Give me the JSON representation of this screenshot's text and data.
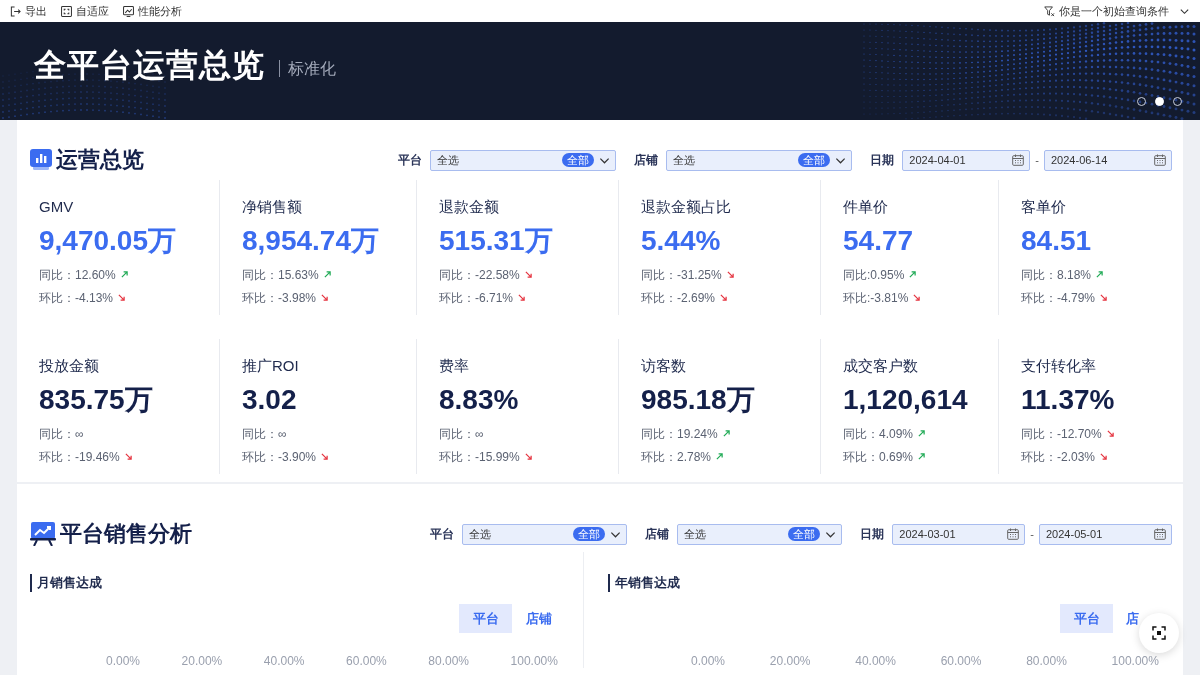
{
  "toolbar": {
    "items": [
      {
        "label": "导出"
      },
      {
        "label": "自适应"
      },
      {
        "label": "性能分析"
      }
    ],
    "query": {
      "label": "你是一个初始查询条件"
    }
  },
  "banner": {
    "title": "全平台运营总览",
    "subtitle": "标准化",
    "slides": [
      {
        "selected": false
      },
      {
        "selected": true
      },
      {
        "selected": false
      }
    ]
  },
  "sections": [
    {
      "kind": "kpi",
      "title": "运营总览",
      "filters": [
        {
          "kind": "select",
          "label": "平台",
          "value": "全选",
          "badge": "全部"
        },
        {
          "kind": "select",
          "label": "店铺",
          "value": "全选",
          "badge": "全部"
        },
        {
          "kind": "date_range",
          "label": "日期",
          "start": "2024-04-01",
          "separator": "-",
          "end": "2024-06-14"
        }
      ],
      "kpi_rows": [
        {
          "highlighted": true,
          "items": [
            {
              "label": "GMV",
              "value": "9,470.05万",
              "comparisons": [
                {
                  "kind": "up",
                  "text": "同比：12.60%"
                },
                {
                  "kind": "down",
                  "text": "环比：-4.13%"
                }
              ]
            },
            {
              "label": "净销售额",
              "value": "8,954.74万",
              "comparisons": [
                {
                  "kind": "up",
                  "text": "同比：15.63%"
                },
                {
                  "kind": "down",
                  "text": "环比：-3.98%"
                }
              ]
            },
            {
              "label": "退款金额",
              "value": "515.31万",
              "comparisons": [
                {
                  "kind": "down",
                  "text": "同比：-22.58%"
                },
                {
                  "kind": "down",
                  "text": "环比：-6.71%"
                }
              ]
            },
            {
              "label": "退款金额占比",
              "value": "5.44%",
              "comparisons": [
                {
                  "kind": "down",
                  "text": "同比：-31.25%"
                },
                {
                  "kind": "down",
                  "text": "环比：-2.69%"
                }
              ]
            },
            {
              "label": "件单价",
              "value": "54.77",
              "comparisons": [
                {
                  "kind": "up",
                  "text": "同比:0.95%"
                },
                {
                  "kind": "down",
                  "text": "环比:-3.81%"
                }
              ]
            },
            {
              "label": "客单价",
              "value": "84.51",
              "comparisons": [
                {
                  "kind": "up",
                  "text": "同比：8.18%"
                },
                {
                  "kind": "down",
                  "text": "环比：-4.79%"
                }
              ]
            }
          ]
        },
        {
          "highlighted": false,
          "items": [
            {
              "label": "投放金额",
              "value": "835.75万",
              "comparisons": [
                {
                  "kind": "plain",
                  "text": "同比：∞"
                },
                {
                  "kind": "down",
                  "text": "环比：-19.46%"
                }
              ]
            },
            {
              "label": "推广ROI",
              "value": "3.02",
              "comparisons": [
                {
                  "kind": "plain",
                  "text": "同比：∞"
                },
                {
                  "kind": "down",
                  "text": "环比：-3.90%"
                }
              ]
            },
            {
              "label": "费率",
              "value": "8.83%",
              "comparisons": [
                {
                  "kind": "plain",
                  "text": "同比：∞"
                },
                {
                  "kind": "down",
                  "text": "环比：-15.99%"
                }
              ]
            },
            {
              "label": "访客数",
              "value": "985.18万",
              "comparisons": [
                {
                  "kind": "up",
                  "text": "同比：19.24%"
                },
                {
                  "kind": "up",
                  "text": "环比：2.78%"
                }
              ]
            },
            {
              "label": "成交客户数",
              "value": "1,120,614",
              "comparisons": [
                {
                  "kind": "up",
                  "text": "同比：4.09%"
                },
                {
                  "kind": "up",
                  "text": "环比：0.69%"
                }
              ]
            },
            {
              "label": "支付转化率",
              "value": "11.37%",
              "comparisons": [
                {
                  "kind": "down",
                  "text": "同比：-12.70%"
                },
                {
                  "kind": "down",
                  "text": "环比：-2.03%"
                }
              ]
            }
          ]
        }
      ]
    },
    {
      "kind": "charts",
      "title": "平台销售分析",
      "filters": [
        {
          "kind": "select",
          "label": "平台",
          "value": "全选",
          "badge": "全部"
        },
        {
          "kind": "select",
          "label": "店铺",
          "value": "全选",
          "badge": "全部"
        },
        {
          "kind": "date_range",
          "label": "日期",
          "start": "2024-03-01",
          "separator": "-",
          "end": "2024-05-01"
        }
      ],
      "panels": [
        {
          "title": "月销售达成",
          "toggle": [
            {
              "label": "平台",
              "selected": true
            },
            {
              "label": "店铺",
              "selected": false
            }
          ],
          "axis_ticks": [
            "0.00%",
            "20.00%",
            "40.00%",
            "60.00%",
            "80.00%",
            "100.00%"
          ]
        },
        {
          "title": "年销售达成",
          "toggle": [
            {
              "label": "平台",
              "selected": true
            },
            {
              "label": "店",
              "selected": false
            }
          ],
          "axis_ticks": [
            "0.00%",
            "20.00%",
            "40.00%",
            "60.00%",
            "80.00%",
            "100.00%"
          ]
        }
      ]
    }
  ]
}
